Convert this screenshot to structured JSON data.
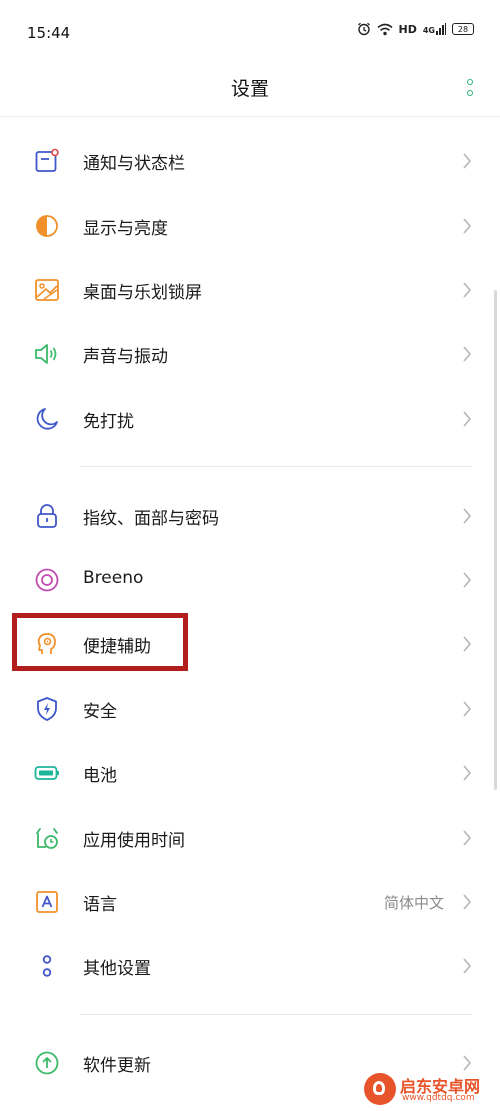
{
  "status_bar": {
    "time": "15:44",
    "hd": "HD",
    "network": "4G",
    "battery": "28",
    "icons": [
      "alarm-icon",
      "wifi-icon",
      "signal-icon",
      "battery-icon"
    ]
  },
  "header": {
    "title": "设置",
    "more_icon": "more-vertical-icon",
    "accent_color": "#2bb673"
  },
  "settings": {
    "group1": [
      {
        "label": "通知与状态栏",
        "icon": "notification-bar-icon",
        "color": "#e04848"
      },
      {
        "label": "显示与亮度",
        "icon": "brightness-icon",
        "color": "#f0902a"
      },
      {
        "label": "桌面与乐划锁屏",
        "icon": "wallpaper-icon",
        "color": "#f0902a"
      },
      {
        "label": "声音与振动",
        "icon": "speaker-icon",
        "color": "#3cba6a"
      },
      {
        "label": "免打扰",
        "icon": "moon-icon",
        "color": "#3f57c9"
      }
    ],
    "group2": [
      {
        "label": "指纹、面部与密码",
        "icon": "lock-icon",
        "color": "#3f57c9"
      },
      {
        "label": "Breeno",
        "icon": "breeno-icon",
        "color": "#c44bb0"
      },
      {
        "label": "便捷辅助",
        "icon": "accessibility-head-icon",
        "color": "#f0902a"
      },
      {
        "label": "安全",
        "icon": "shield-icon",
        "color": "#3f57c9"
      },
      {
        "label": "电池",
        "icon": "battery-setting-icon",
        "color": "#1fb59a"
      },
      {
        "label": "应用使用时间",
        "icon": "app-timer-icon",
        "color": "#3cba6a"
      },
      {
        "label": "语言",
        "icon": "language-icon",
        "color": "#f0902a",
        "value": "简体中文"
      },
      {
        "label": "其他设置",
        "icon": "other-settings-icon",
        "color": "#3f57c9"
      }
    ],
    "group3": [
      {
        "label": "软件更新",
        "icon": "update-icon",
        "color": "#3cba6a"
      }
    ]
  },
  "watermark": {
    "title": "启东安卓网",
    "url": "www.qdtdq.com",
    "color": "#e8542a"
  }
}
